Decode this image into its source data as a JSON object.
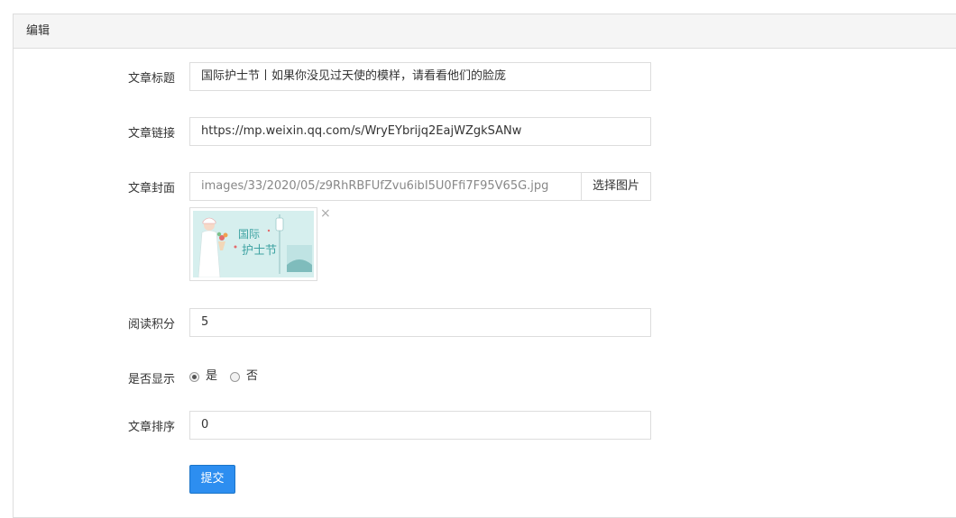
{
  "panel": {
    "heading": "编辑"
  },
  "form": {
    "title": {
      "label": "文章标题",
      "value": "国际护士节丨如果你没见过天使的模样，请看看他们的脸庞"
    },
    "link": {
      "label": "文章链接",
      "value": "https://mp.weixin.qq.com/s/WryEYbrijq2EajWZgkSANw"
    },
    "cover": {
      "label": "文章封面",
      "value": "images/33/2020/05/z9RhRBFUfZvu6ibI5U0Ffi7F95V65G.jpg",
      "select_button": "选择图片",
      "thumb_text": "国际 护士节",
      "remove_icon": "×"
    },
    "points": {
      "label": "阅读积分",
      "value": "5"
    },
    "display": {
      "label": "是否显示",
      "options": [
        {
          "label": "是",
          "checked": true
        },
        {
          "label": "否",
          "checked": false
        }
      ]
    },
    "order": {
      "label": "文章排序",
      "value": "0"
    },
    "submit_label": "提交"
  },
  "colors": {
    "primary": "#2d8ef0",
    "border": "#dddddd",
    "heading_bg": "#f5f5f5"
  }
}
